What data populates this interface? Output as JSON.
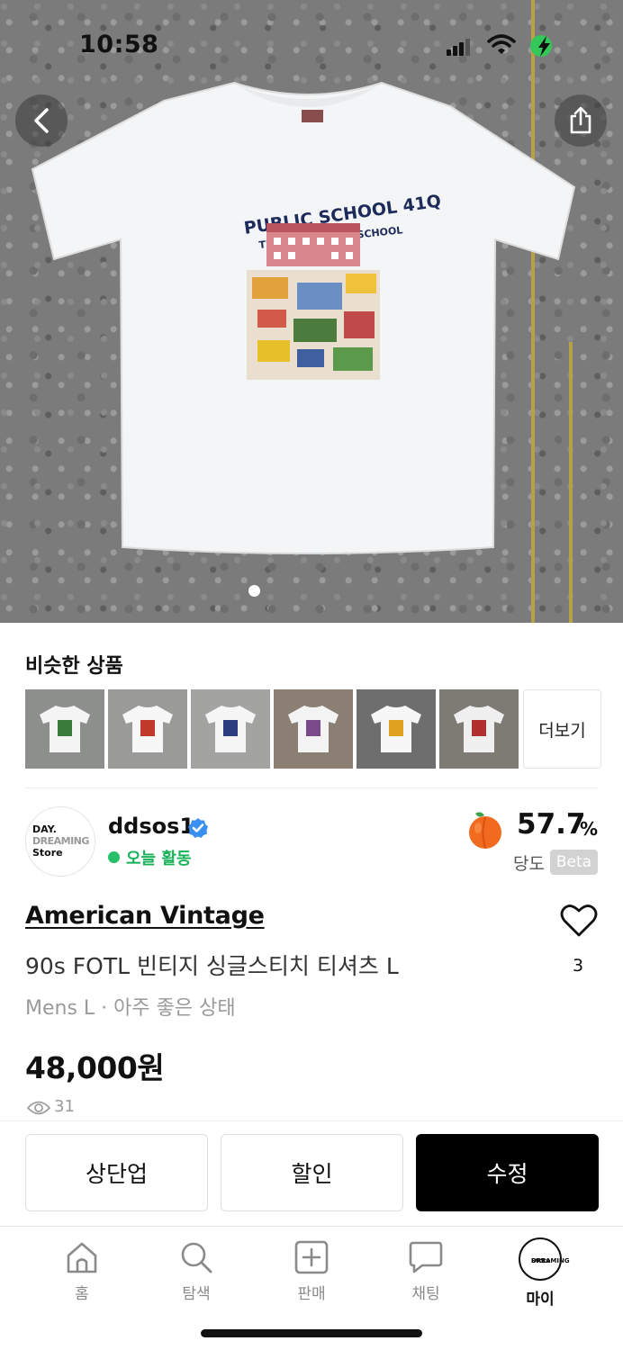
{
  "status_bar": {
    "time": "10:58"
  },
  "hero": {
    "current_page": 1,
    "total_pages": 1
  },
  "similar": {
    "title": "비슷한 상품",
    "more_label": "더보기",
    "thumbs": [
      {
        "bg": "#8d8f8c",
        "shirt": "#f4f4f4",
        "print": "#3a7a3a"
      },
      {
        "bg": "#9a9a98",
        "shirt": "#f7f7f7",
        "print": "#c0392b"
      },
      {
        "bg": "#a3a3a1",
        "shirt": "#f5f5f5",
        "print": "#2c3e80"
      },
      {
        "bg": "#8a7f72",
        "shirt": "#f3f3f3",
        "print": "#7b4a8a"
      },
      {
        "bg": "#6e6e6e",
        "shirt": "#f7f7f7",
        "print": "#e0a020"
      },
      {
        "bg": "#7e7b74",
        "shirt": "#efefef",
        "print": "#b03030"
      }
    ]
  },
  "seller": {
    "name": "ddsos1",
    "status": "오늘 활동",
    "avatar_lines": [
      "DAY.",
      "DREAMING",
      "Store"
    ],
    "score": "57.7",
    "score_unit": "%",
    "score_label": "당도",
    "beta": "Beta"
  },
  "product": {
    "brand": "American Vintage",
    "title": "90s FOTL 빈티지 싱글스티치 티셔츠 L",
    "meta": "Mens L · 아주 좋은 상태",
    "price": "48,000원",
    "likes": "3",
    "views": "31"
  },
  "actions": {
    "bump": "상단업",
    "discount": "할인",
    "edit": "수정"
  },
  "tabs": [
    {
      "label": "홈",
      "icon": "home-icon"
    },
    {
      "label": "탐색",
      "icon": "search-icon"
    },
    {
      "label": "판매",
      "icon": "plus-square-icon"
    },
    {
      "label": "채팅",
      "icon": "chat-icon"
    },
    {
      "label": "마이",
      "icon": "avatar"
    }
  ],
  "tab_avatar_lines": [
    "DAY.",
    "DREAMING",
    "Store"
  ],
  "colors": {
    "accent_green": "#19b15a",
    "verified_blue": "#3b8ff0",
    "peach": "#f06a1f"
  }
}
